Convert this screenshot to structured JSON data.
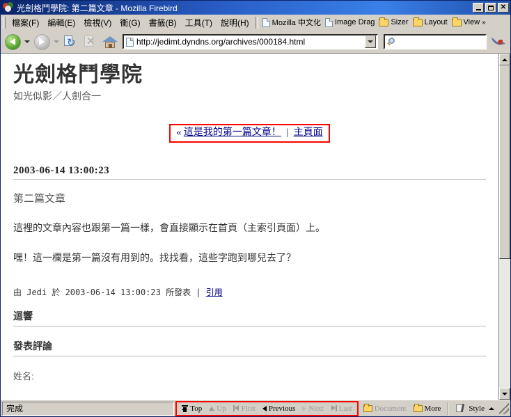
{
  "window": {
    "title": "光劍格鬥學院: 第二篇文章 - Mozilla Firebird",
    "app_icon": "firebird-logo-icon",
    "minimize_label": "",
    "maximize_label": "",
    "close_label": "✕"
  },
  "menubar": {
    "items": [
      {
        "label": "檔案(F)"
      },
      {
        "label": "編輯(E)"
      },
      {
        "label": "檢視(V)"
      },
      {
        "label": "衝(G)"
      },
      {
        "label": "書籤(B)"
      },
      {
        "label": "工具(T)"
      },
      {
        "label": "說明(H)"
      }
    ]
  },
  "bookmarks_toolbar": {
    "items": [
      {
        "label": "Mozilla 中文化",
        "icon": "document-icon"
      },
      {
        "label": "Image Drag",
        "icon": "document-icon"
      },
      {
        "label": "Sizer",
        "icon": "folder-icon"
      },
      {
        "label": "Layout",
        "icon": "folder-icon"
      },
      {
        "label": "View",
        "icon": "folder-icon"
      }
    ],
    "overflow_label": "»"
  },
  "navbar": {
    "back_label": "Back",
    "forward_label": "Forward",
    "reload_label": "Reload",
    "stop_label": "Stop",
    "home_label": "Home",
    "url": "http://jedimt.dyndns.org/archives/000184.html",
    "url_placeholder": "",
    "search_value": "",
    "search_placeholder": ""
  },
  "page": {
    "site_title": "光劍格鬥學院",
    "site_subtitle": "如光似影／人劍合一",
    "nav_links": {
      "prev_arrow": "«",
      "prev_label": "這是我的第一篇文章！",
      "separator": "|",
      "home_label": "主頁面"
    },
    "entry": {
      "date_heading": "2003-06-14 13:00:23",
      "title": "第二篇文章",
      "paragraphs": [
        "這裡的文章內容也跟第一篇一樣，會直接顯示在首頁（主索引頁面）上。",
        "嘿！這一欄是第一篇沒有用到的。找找看，這些字跑到哪兒去了？"
      ],
      "byline_text": "由 Jedi 於 2003-06-14 13:00:23 所發表 |",
      "byline_link": "引用"
    },
    "sections": [
      {
        "heading": "迴響"
      },
      {
        "heading": "發表評論"
      }
    ],
    "form": {
      "name_label": "姓名:"
    }
  },
  "scrollbar": {
    "up_label": "▲",
    "down_label": "▼",
    "thumb_position_percent": 0,
    "thumb_size_percent": 60
  },
  "statusbar": {
    "status_text": "完成",
    "nav_buttons": [
      {
        "label": "Top",
        "icon": "arrow-top-icon",
        "enabled": true
      },
      {
        "label": "Up",
        "icon": "arrow-up-icon",
        "enabled": false
      },
      {
        "label": "First",
        "icon": "arrow-first-icon",
        "enabled": false
      },
      {
        "label": "Previous",
        "icon": "arrow-previous-icon",
        "enabled": true
      },
      {
        "label": "Next",
        "icon": "arrow-next-icon",
        "enabled": false
      },
      {
        "label": "Last",
        "icon": "arrow-last-icon",
        "enabled": false
      }
    ],
    "document_label": "Document",
    "more_label": "More",
    "style_label": "Style",
    "style_caret": "▲"
  },
  "colors": {
    "highlight_box": "#ff0000",
    "link": "#00008b",
    "titlebar_start": "#0a246a",
    "chrome": "#d4d0c8"
  }
}
